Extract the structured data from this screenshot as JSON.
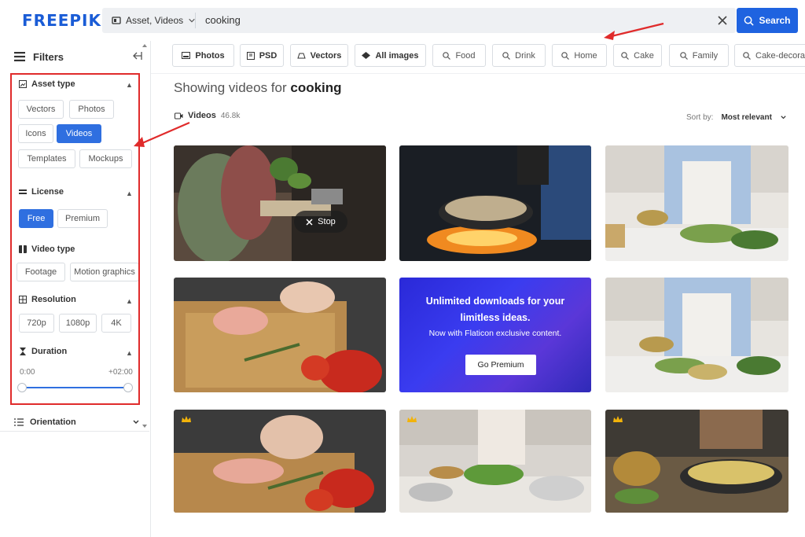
{
  "brand": {
    "logo_text": "FREEPIK",
    "accent": "#1f63e0"
  },
  "search": {
    "asset_label": "Asset, Videos",
    "query": "cooking",
    "button_label": "Search"
  },
  "filters": {
    "title": "Filters",
    "asset_type": {
      "title": "Asset type",
      "options": [
        "Vectors",
        "Photos",
        "Icons",
        "Videos",
        "Templates",
        "Mockups"
      ],
      "selected": "Videos"
    },
    "license": {
      "title": "License",
      "options": [
        "Free",
        "Premium"
      ],
      "selected": "Free"
    },
    "video_type": {
      "title": "Video type",
      "options": [
        "Footage",
        "Motion graphics"
      ]
    },
    "resolution": {
      "title": "Resolution",
      "options": [
        "720p",
        "1080p",
        "4K"
      ]
    },
    "duration": {
      "title": "Duration",
      "min_label": "0:00",
      "max_label": "+02:00",
      "range_start": 0.0,
      "range_end": 1.0
    },
    "orientation": {
      "title": "Orientation"
    }
  },
  "pills": [
    "Photos",
    "PSD",
    "Vectors",
    "All images",
    "Food",
    "Drink",
    "Home",
    "Cake",
    "Family",
    "Cake-decorating"
  ],
  "results": {
    "heading_prefix": "Showing videos for",
    "heading_query": "cooking",
    "videos_label": "Videos",
    "videos_count": "46.8k",
    "sort_label": "Sort by:",
    "sort_value": "Most relevant"
  },
  "hover": {
    "stop_label": "Stop"
  },
  "promo": {
    "line1": "Unlimited downloads for your",
    "line2": "limitless ideas.",
    "line3": "Now with Flaticon exclusive content.",
    "button": "Go Premium"
  },
  "annotations": {
    "color": "#e02b2b"
  }
}
